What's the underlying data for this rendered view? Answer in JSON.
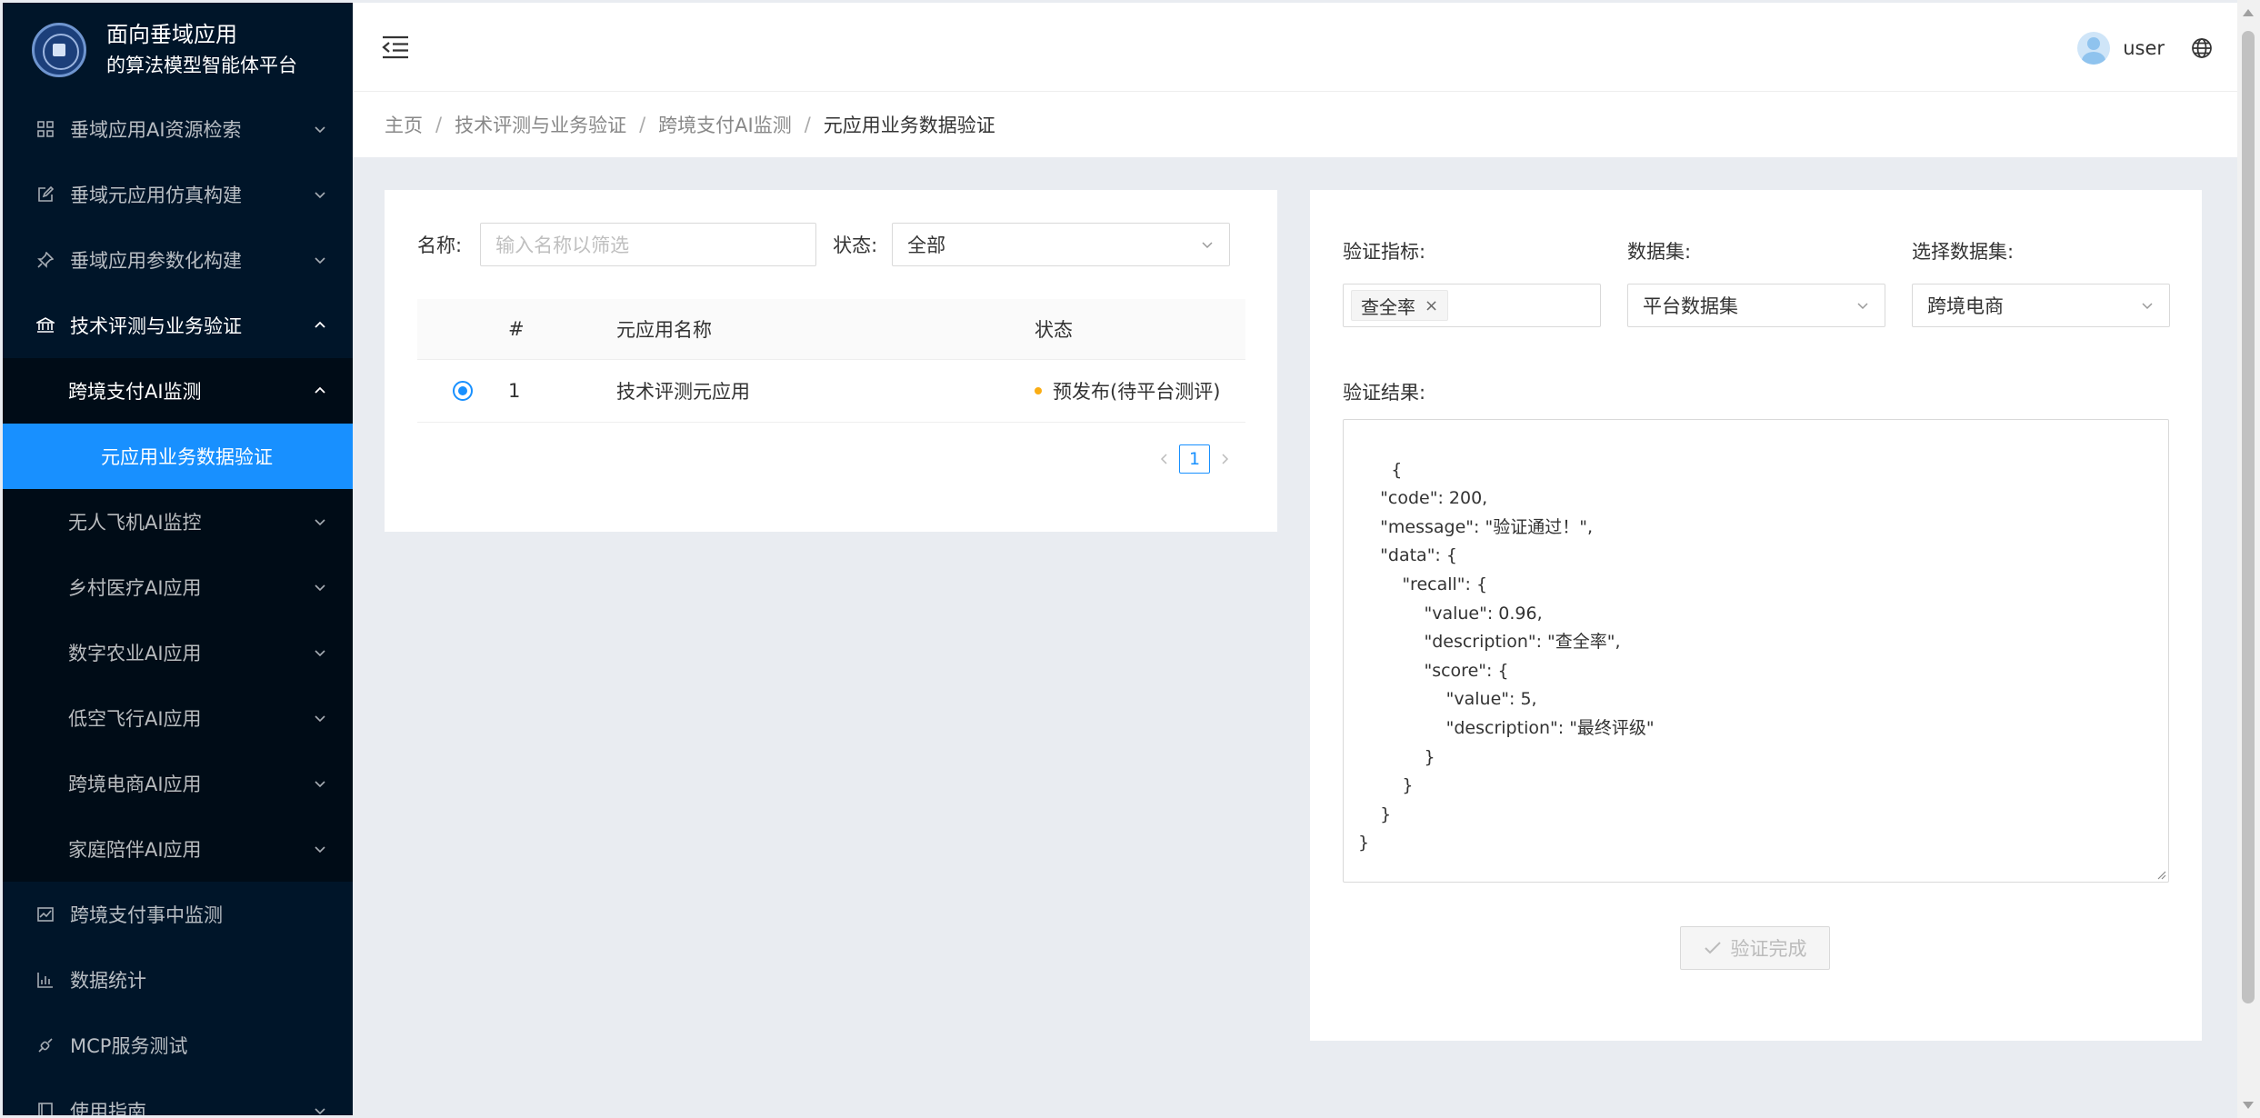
{
  "sidebar": {
    "logo": {
      "line1": "面向垂域应用",
      "line2": "的算法模型智能体平台",
      "seal_text": "校徽"
    },
    "items": [
      {
        "label": "垂域应用AI资源检索",
        "icon": "appstore-icon"
      },
      {
        "label": "垂域元应用仿真构建",
        "icon": "edit-icon"
      },
      {
        "label": "垂域应用参数化构建",
        "icon": "pushpin-icon"
      },
      {
        "label": "技术评测与业务验证",
        "icon": "bank-icon"
      }
    ],
    "sub_open": {
      "label": "跨境支付AI监测",
      "child": "元应用业务数据验证"
    },
    "sub_items": [
      {
        "label": "无人飞机AI监控"
      },
      {
        "label": "乡村医疗AI应用"
      },
      {
        "label": "数字农业AI应用"
      },
      {
        "label": "低空飞行AI应用"
      },
      {
        "label": "跨境电商AI应用"
      },
      {
        "label": "家庭陪伴AI应用"
      }
    ],
    "bottom_items": [
      {
        "label": "跨境支付事中监测",
        "icon": "line-chart-icon"
      },
      {
        "label": "数据统计",
        "icon": "bar-chart-icon"
      },
      {
        "label": "MCP服务测试",
        "icon": "api-icon"
      },
      {
        "label": "使用指南",
        "icon": "book-icon"
      }
    ]
  },
  "header": {
    "user_name": "user"
  },
  "breadcrumb": [
    "主页",
    "技术评测与业务验证",
    "跨境支付AI监测",
    "元应用业务数据验证"
  ],
  "filter": {
    "name_label": "名称:",
    "name_placeholder": "输入名称以筛选",
    "status_label": "状态:",
    "status_value": "全部"
  },
  "table": {
    "headers": [
      "#",
      "元应用名称",
      "状态"
    ],
    "rows": [
      {
        "index": "1",
        "name": "技术评测元应用",
        "status": "预发布(待平台测评)",
        "selected": true
      }
    ]
  },
  "pagination": {
    "current": "1"
  },
  "verify": {
    "metric_label": "验证指标:",
    "metric_tag": "查全率",
    "dataset_label": "数据集:",
    "dataset_value": "平台数据集",
    "choose_label": "选择数据集:",
    "choose_value": "跨境电商",
    "result_label": "验证结果:",
    "result_text": "{\n    \"code\": 200,\n    \"message\": \"验证通过！\",\n    \"data\": {\n        \"recall\": {\n            \"value\": 0.96,\n            \"description\": \"查全率\",\n            \"score\": {\n                \"value\": 5,\n                \"description\": \"最终评级\"\n            }\n        }\n    }\n}",
    "done_button": "验证完成"
  },
  "colors": {
    "sidebar_bg": "#001529",
    "submenu_bg": "#000c17",
    "accent": "#1890ff",
    "status_dot": "#faad14"
  }
}
